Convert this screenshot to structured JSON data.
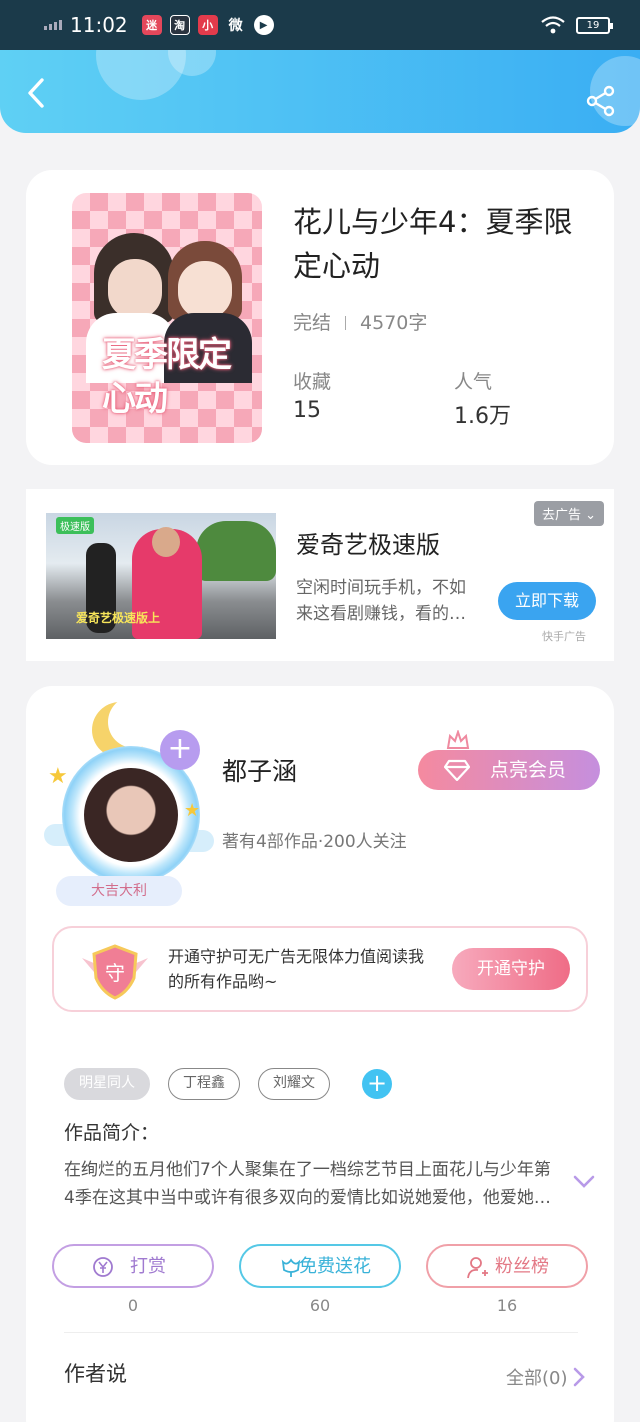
{
  "status_bar": {
    "time": "11:02",
    "battery": "19",
    "apps": [
      {
        "icon": "app-icon-1",
        "glyph": "迷",
        "color": "#e4475b"
      },
      {
        "icon": "taobao-icon",
        "glyph": "淘",
        "color": "#333a44"
      },
      {
        "icon": "app-icon-3",
        "glyph": "小",
        "color": "#e33b4c"
      },
      {
        "icon": "weibo-icon",
        "glyph": "微",
        "color": "#1b3a4a"
      },
      {
        "icon": "play-icon",
        "glyph": "▶",
        "color": "#1b3a4a"
      }
    ]
  },
  "header": {
    "back_icon": "back-arrow-icon",
    "share_icon": "share-icon"
  },
  "book": {
    "cover_text": "夏季限定心动",
    "title": "花儿与少年4：夏季限定心动",
    "status": "完结",
    "word_count": "4570字",
    "favorites_label": "收藏",
    "favorites_value": "15",
    "popularity_label": "人气",
    "popularity_value": "1.6万"
  },
  "ad": {
    "image_tag": "极速版",
    "image_caption": "爱奇艺极速版上",
    "title": "爱奇艺极速版",
    "description": "空闲时间玩手机，不如来这看剧赚钱，看的…",
    "close_label": "去广告 ⌄",
    "button_label": "立即下载",
    "source": "快手广告"
  },
  "author": {
    "name": "都子涵",
    "meta": "著有4部作品·200人关注",
    "nick_tag": "大吉大利",
    "vip_label": "点亮会员",
    "guard_text": "开通守护可无广告无限体力值阅读我的所有作品哟~",
    "guard_shield_text": "守",
    "guard_button": "开通守护",
    "tags": [
      "明星同人",
      "丁程鑫",
      "刘耀文"
    ],
    "intro_label": "作品简介：",
    "intro_text": "在绚烂的五月他们7个人聚集在了一档综艺节目上面花儿与少年第4季在这其中当中或许有很多双向的爱情比如说她爱他，他爱她…"
  },
  "actions": {
    "reward_label": "打赏",
    "reward_count": "0",
    "flower_label": "免费送花",
    "flower_count": "60",
    "fans_label": "粉丝榜",
    "fans_count": "16"
  },
  "author_says": {
    "label": "作者说",
    "all_label": "全部(0)"
  },
  "colors": {
    "header_start": "#5fd0f4",
    "header_end": "#3aaef3",
    "accent_pink": "#ef6c86",
    "accent_purple": "#b79cef",
    "download_blue": "#3aa4f0"
  }
}
